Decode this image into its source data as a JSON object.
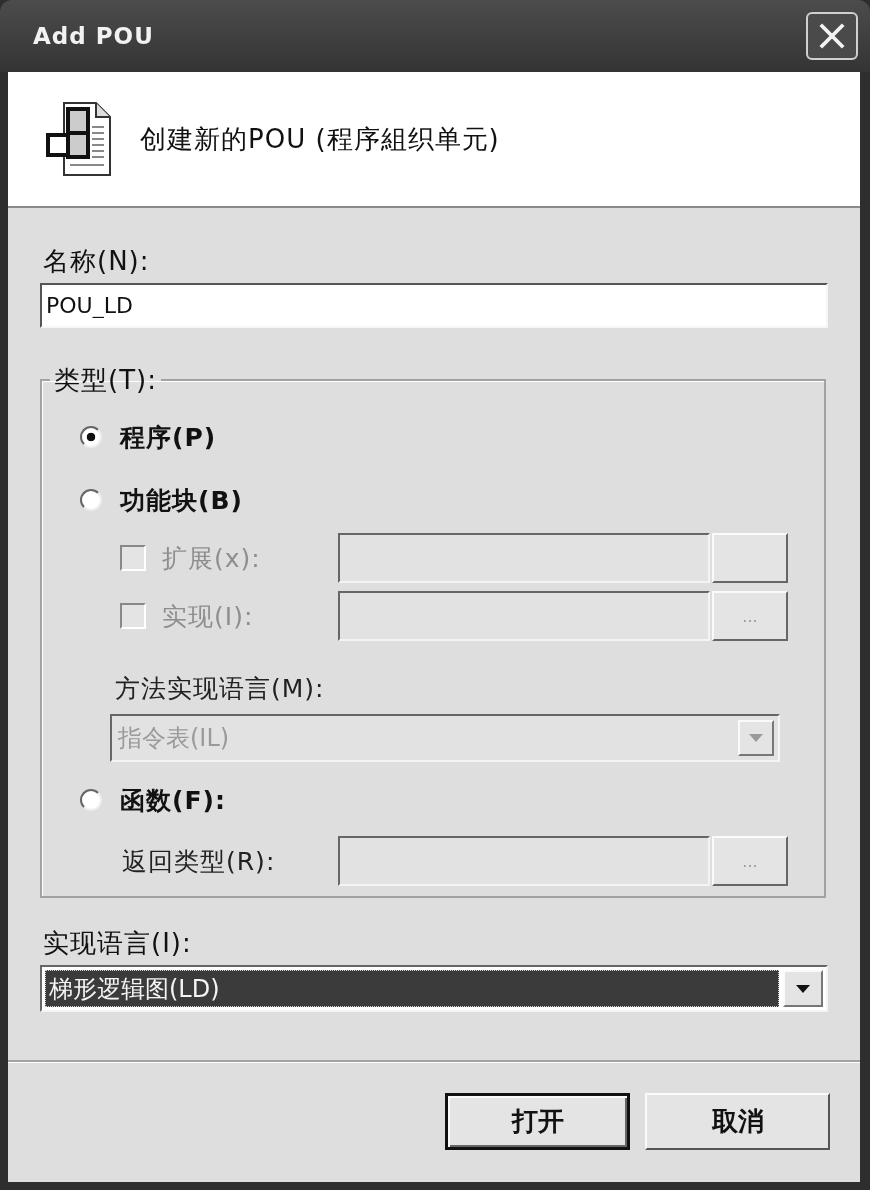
{
  "window": {
    "title": "Add POU"
  },
  "header": {
    "text": "创建新的POU (程序組织单元)"
  },
  "name": {
    "label": "名称(N):",
    "value": "POU_LD"
  },
  "type_group": {
    "label": "类型(T):",
    "options": [
      {
        "label": "程序(P)",
        "selected": true
      },
      {
        "label": "功能块(B)",
        "selected": false,
        "controls": [
          {
            "kind": "checkbox_field",
            "label": "扩展(x):",
            "checked": false,
            "disabled": true
          },
          {
            "kind": "checkbox_field",
            "label": "实现(I):",
            "checked": false,
            "disabled": true,
            "button_label": "..."
          },
          {
            "kind": "dropdown",
            "label": "方法实现语言(M):",
            "value": "指令表(IL)",
            "disabled": true
          }
        ]
      },
      {
        "label": "函数(F):",
        "selected": false,
        "controls": [
          {
            "kind": "field",
            "label": "返回类型(R):",
            "disabled": true,
            "button_label": "..."
          }
        ]
      }
    ]
  },
  "language": {
    "label": "实现语言(I):",
    "value": "梯形逻辑图(LD)",
    "highlighted": true
  },
  "buttons": [
    {
      "label": "打开",
      "default": true
    },
    {
      "label": "取消",
      "default": false
    }
  ]
}
